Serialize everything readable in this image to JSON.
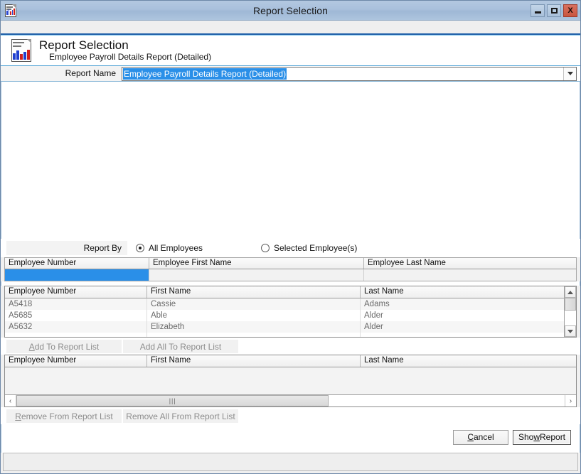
{
  "window": {
    "title": "Report Selection",
    "icon": "report-document-chart-icon",
    "controls": {
      "minimize": "minimize-icon",
      "maximize": "maximize-icon",
      "close": "X"
    }
  },
  "header": {
    "icon": "report-document-chart-icon",
    "title": "Report Selection",
    "subtitle": "Employee Payroll Details Report (Detailed)"
  },
  "report_name": {
    "label": "Report Name",
    "value": "Employee Payroll Details Report (Detailed)",
    "selected": true,
    "arrow_icon": "chevron-down-icon"
  },
  "report_by": {
    "label": "Report By",
    "options": [
      {
        "label": "All Employees",
        "checked": true
      },
      {
        "label": "Selected Employee(s)",
        "checked": false
      }
    ]
  },
  "filter_grid": {
    "columns": [
      "Employee Number",
      "Employee First Name",
      "Employee Last Name"
    ],
    "filter_values": [
      "",
      "",
      ""
    ],
    "selected_column_index": 0
  },
  "available_grid": {
    "columns": [
      "Employee Number",
      "First Name",
      "Last Name"
    ],
    "rows": [
      {
        "number": "A5418",
        "first": "Cassie",
        "last": "Adams"
      },
      {
        "number": "A5685",
        "first": "Able",
        "last": "Alder"
      },
      {
        "number": "A5632",
        "first": "Elizabeth",
        "last": "Alder"
      }
    ],
    "scrollbar": {
      "up_icon": "caret-up-icon",
      "down_icon": "caret-down-icon"
    }
  },
  "add_buttons": {
    "add": "Add To Report List",
    "add_accel": "A",
    "add_rest": "dd To Report List",
    "add_all": "Add All To Report List",
    "enabled": false
  },
  "report_list_grid": {
    "columns": [
      "Employee Number",
      "First Name",
      "Last Name"
    ],
    "rows": [],
    "hscroll": {
      "left_icon": "chevron-left-icon",
      "right_icon": "chevron-right-icon",
      "grip": "|||"
    }
  },
  "remove_buttons": {
    "remove_accel": "R",
    "remove_rest": "emove From Report List",
    "remove_all": "Remove All From Report List",
    "enabled": false
  },
  "actions": {
    "cancel_accel": "C",
    "cancel_rest": "ancel",
    "show_pre": "Sho",
    "show_accel": "w",
    "show_rest": " Report"
  },
  "status_bar": {
    "text": ""
  },
  "colors": {
    "titlebar": "#a9c0dc",
    "close_button": "#c8553f",
    "accent_blue": "#2a8fe8",
    "header_rule": "#1f5fa8",
    "window_border": "#6d88a8"
  }
}
